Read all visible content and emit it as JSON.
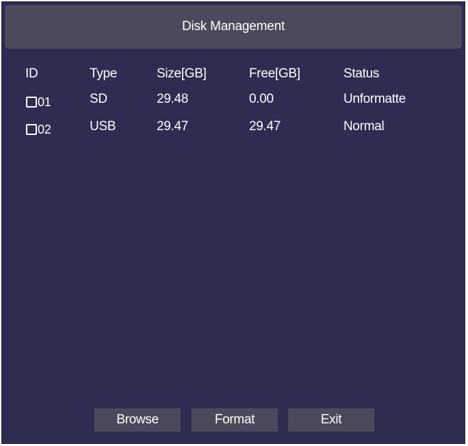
{
  "title": "Disk Management",
  "columns": {
    "id": "ID",
    "type": "Type",
    "size": "Size[GB]",
    "free": "Free[GB]",
    "status": "Status"
  },
  "rows": [
    {
      "id": "01",
      "type": "SD",
      "size": "29.48",
      "free": "0.00",
      "status": "Unformatte"
    },
    {
      "id": "02",
      "type": "USB",
      "size": "29.47",
      "free": "29.47",
      "status": "Normal"
    }
  ],
  "buttons": {
    "browse": "Browse",
    "format": "Format",
    "exit": "Exit"
  }
}
